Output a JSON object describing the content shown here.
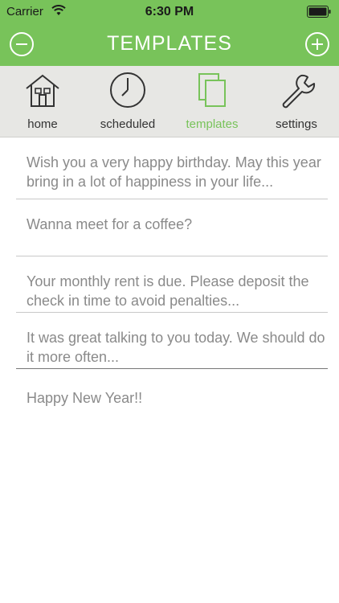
{
  "status_bar": {
    "carrier": "Carrier",
    "time": "6:30 PM"
  },
  "nav": {
    "title": "TEMPLATES",
    "left_icon": "minus-circle-icon",
    "right_icon": "plus-circle-icon"
  },
  "tabs": [
    {
      "label": "home",
      "icon": "house-icon",
      "active": false
    },
    {
      "label": "scheduled",
      "icon": "clock-icon",
      "active": false
    },
    {
      "label": "templates",
      "icon": "pages-icon",
      "active": true
    },
    {
      "label": "settings",
      "icon": "wrench-icon",
      "active": false
    }
  ],
  "templates": [
    {
      "text": "Wish you a very happy birthday. May this year bring in a lot of happiness in your life..."
    },
    {
      "text": "Wanna meet for a coffee?"
    },
    {
      "text": "Your monthly rent is due. Please deposit the check in time to avoid penalties..."
    },
    {
      "text": "It was great talking to you today. We should do it more often..."
    },
    {
      "text": "Happy New Year!!"
    }
  ],
  "colors": {
    "accent": "#78c35a",
    "tab_bar_bg": "#e7e7e4",
    "item_text": "#8a8a8a"
  }
}
